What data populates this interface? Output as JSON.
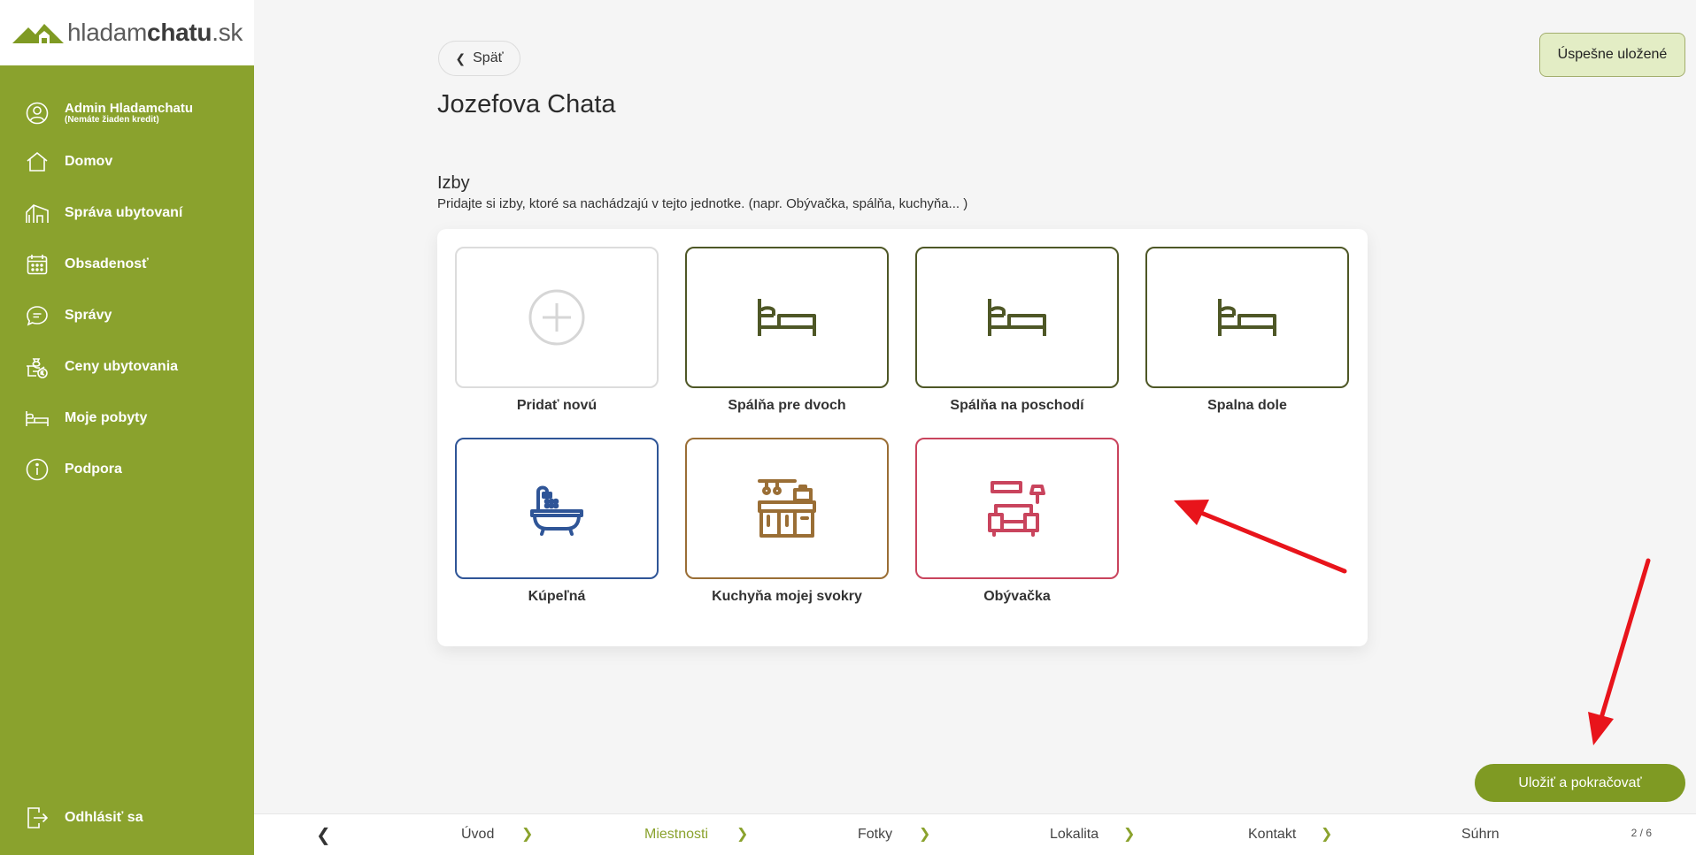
{
  "logo": {
    "prefix": "hladam",
    "brand": "chatu",
    "tld": ".sk"
  },
  "user": {
    "name": "Admin Hladamchatu",
    "credit_note": "(Nemáte žiaden kredit)"
  },
  "sidebar": {
    "items": [
      {
        "label": "Domov",
        "icon": "home-icon"
      },
      {
        "label": "Správa ubytovaní",
        "icon": "cabin-icon"
      },
      {
        "label": "Obsadenosť",
        "icon": "calendar-icon"
      },
      {
        "label": "Správy",
        "icon": "chat-icon"
      },
      {
        "label": "Ceny ubytovania",
        "icon": "money-icon"
      },
      {
        "label": "Moje pobyty",
        "icon": "bed-icon"
      },
      {
        "label": "Podpora",
        "icon": "info-icon"
      }
    ],
    "logout_label": "Odhlásiť sa"
  },
  "header": {
    "back_label": "Späť",
    "title": "Jozefova Chata",
    "saved_label": "Úspešne uložené"
  },
  "rooms_section": {
    "title": "Izby",
    "description": "Pridajte si izby, ktoré sa nachádzajú v tejto jednotke. (napr. Obývačka, spálňa, kuchyňa... )",
    "add_label": "Pridať novú",
    "rooms": [
      {
        "label": "Spálňa pre dvoch",
        "icon": "bed-icon",
        "color": "#4e5726"
      },
      {
        "label": "Spálňa na poschodí",
        "icon": "bed-icon",
        "color": "#4e5726"
      },
      {
        "label": "Spalna dole",
        "icon": "bed-icon",
        "color": "#4e5726"
      },
      {
        "label": "Kúpeľná",
        "icon": "bathtub-icon",
        "color": "#2f5597"
      },
      {
        "label": "Kuchyňa mojej svokry",
        "icon": "kitchen-icon",
        "color": "#9a6e35"
      },
      {
        "label": "Obývačka",
        "icon": "sofa-icon",
        "color": "#c9445d"
      }
    ]
  },
  "actions": {
    "save_continue_label": "Uložiť a pokračovať"
  },
  "stepper": {
    "steps": [
      {
        "label": "Úvod",
        "active": false
      },
      {
        "label": "Miestnosti",
        "active": true
      },
      {
        "label": "Fotky",
        "active": false
      },
      {
        "label": "Lokalita",
        "active": false
      },
      {
        "label": "Kontakt",
        "active": false
      },
      {
        "label": "Súhrn",
        "active": false
      }
    ],
    "counter": "2 / 6"
  },
  "colors": {
    "sidebar": "#8aa22d",
    "accent": "#7f9a23",
    "annotation_arrow": "#e8141b"
  }
}
